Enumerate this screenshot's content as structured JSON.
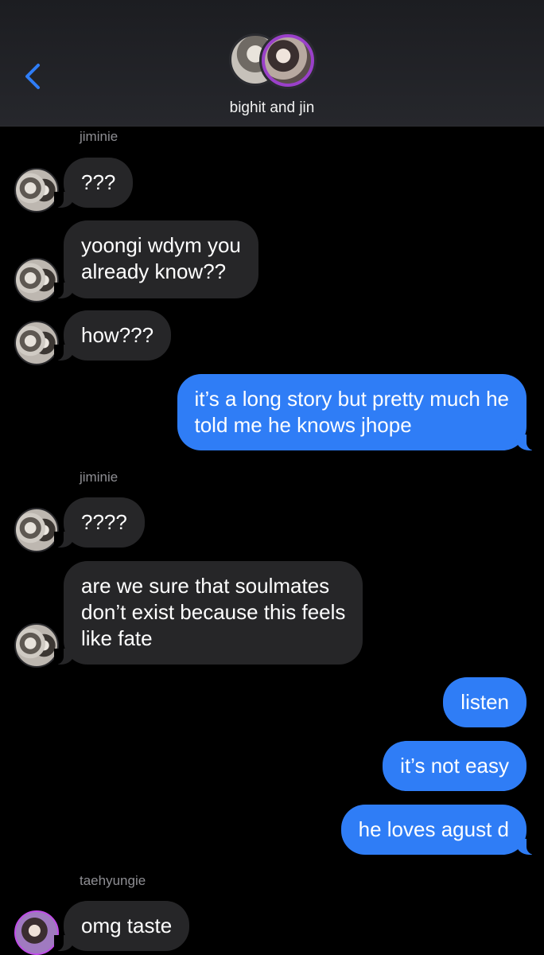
{
  "header": {
    "group_name": "bighit and jin",
    "accent": "#2f7df6"
  },
  "icons": {
    "back": "chevron-left-icon"
  },
  "messages": [
    {
      "type": "sender",
      "text": "jiminie"
    },
    {
      "type": "incoming",
      "text": "???"
    },
    {
      "type": "incoming",
      "text": "yoongi wdym you\nalready know??"
    },
    {
      "type": "incoming",
      "text": "how???"
    },
    {
      "type": "outgoing",
      "text": "it’s a long story but pretty much he\ntold me he knows jhope"
    },
    {
      "type": "sender",
      "text": "jiminie"
    },
    {
      "type": "incoming",
      "text": "????"
    },
    {
      "type": "incoming",
      "text": "are we sure that soulmates\ndon’t exist because this feels\nlike fate"
    },
    {
      "type": "outgoing",
      "text": "listen"
    },
    {
      "type": "outgoing",
      "text": "it’s not easy"
    },
    {
      "type": "outgoing",
      "text": "he loves agust d"
    },
    {
      "type": "sender",
      "text": "taehyungie"
    },
    {
      "type": "incoming",
      "text": "omg taste"
    }
  ]
}
